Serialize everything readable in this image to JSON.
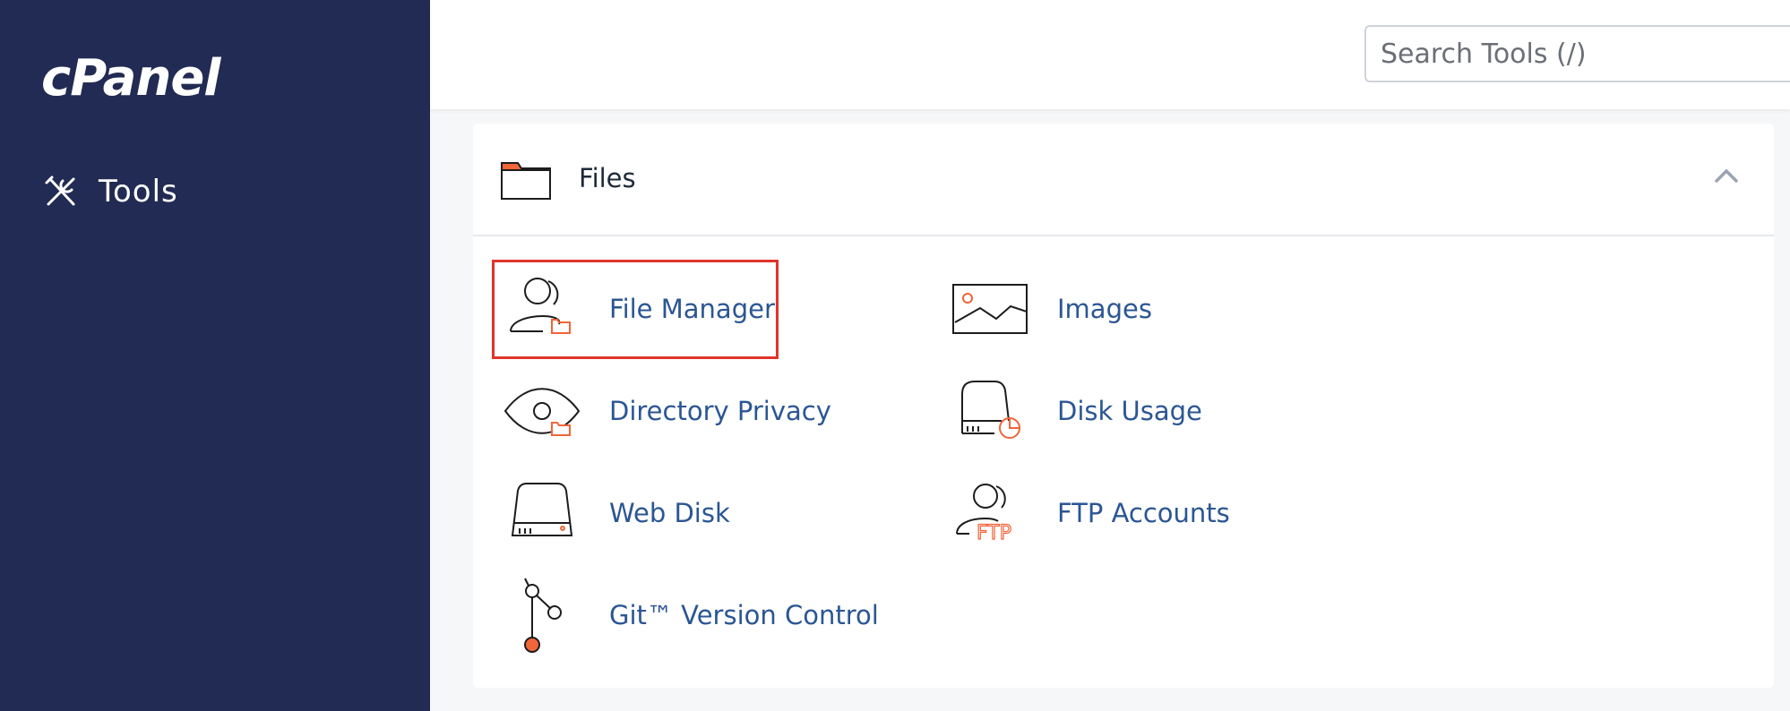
{
  "sidebar": {
    "logo": "cPanel",
    "nav": [
      {
        "label": "Tools",
        "icon": "tools-icon"
      }
    ]
  },
  "header": {
    "search_placeholder": "Search Tools (/)"
  },
  "files_panel": {
    "title": "Files",
    "icon": "folder-icon",
    "collapse_icon": "chevron-up-icon",
    "tools": [
      {
        "label": "File Manager",
        "icon": "file-manager-icon",
        "highlighted": true
      },
      {
        "label": "Images",
        "icon": "images-icon"
      },
      {
        "label": "Directory Privacy",
        "icon": "directory-privacy-icon"
      },
      {
        "label": "Disk Usage",
        "icon": "disk-usage-icon"
      },
      {
        "label": "Web Disk",
        "icon": "web-disk-icon"
      },
      {
        "label": "FTP Accounts",
        "icon": "ftp-accounts-icon"
      },
      {
        "label": "Git™ Version Control",
        "icon": "git-icon"
      }
    ]
  },
  "colors": {
    "sidebar_bg": "#222b53",
    "link": "#2b5694",
    "accent_orange": "#f0653a",
    "highlight_border": "#e0352b"
  }
}
